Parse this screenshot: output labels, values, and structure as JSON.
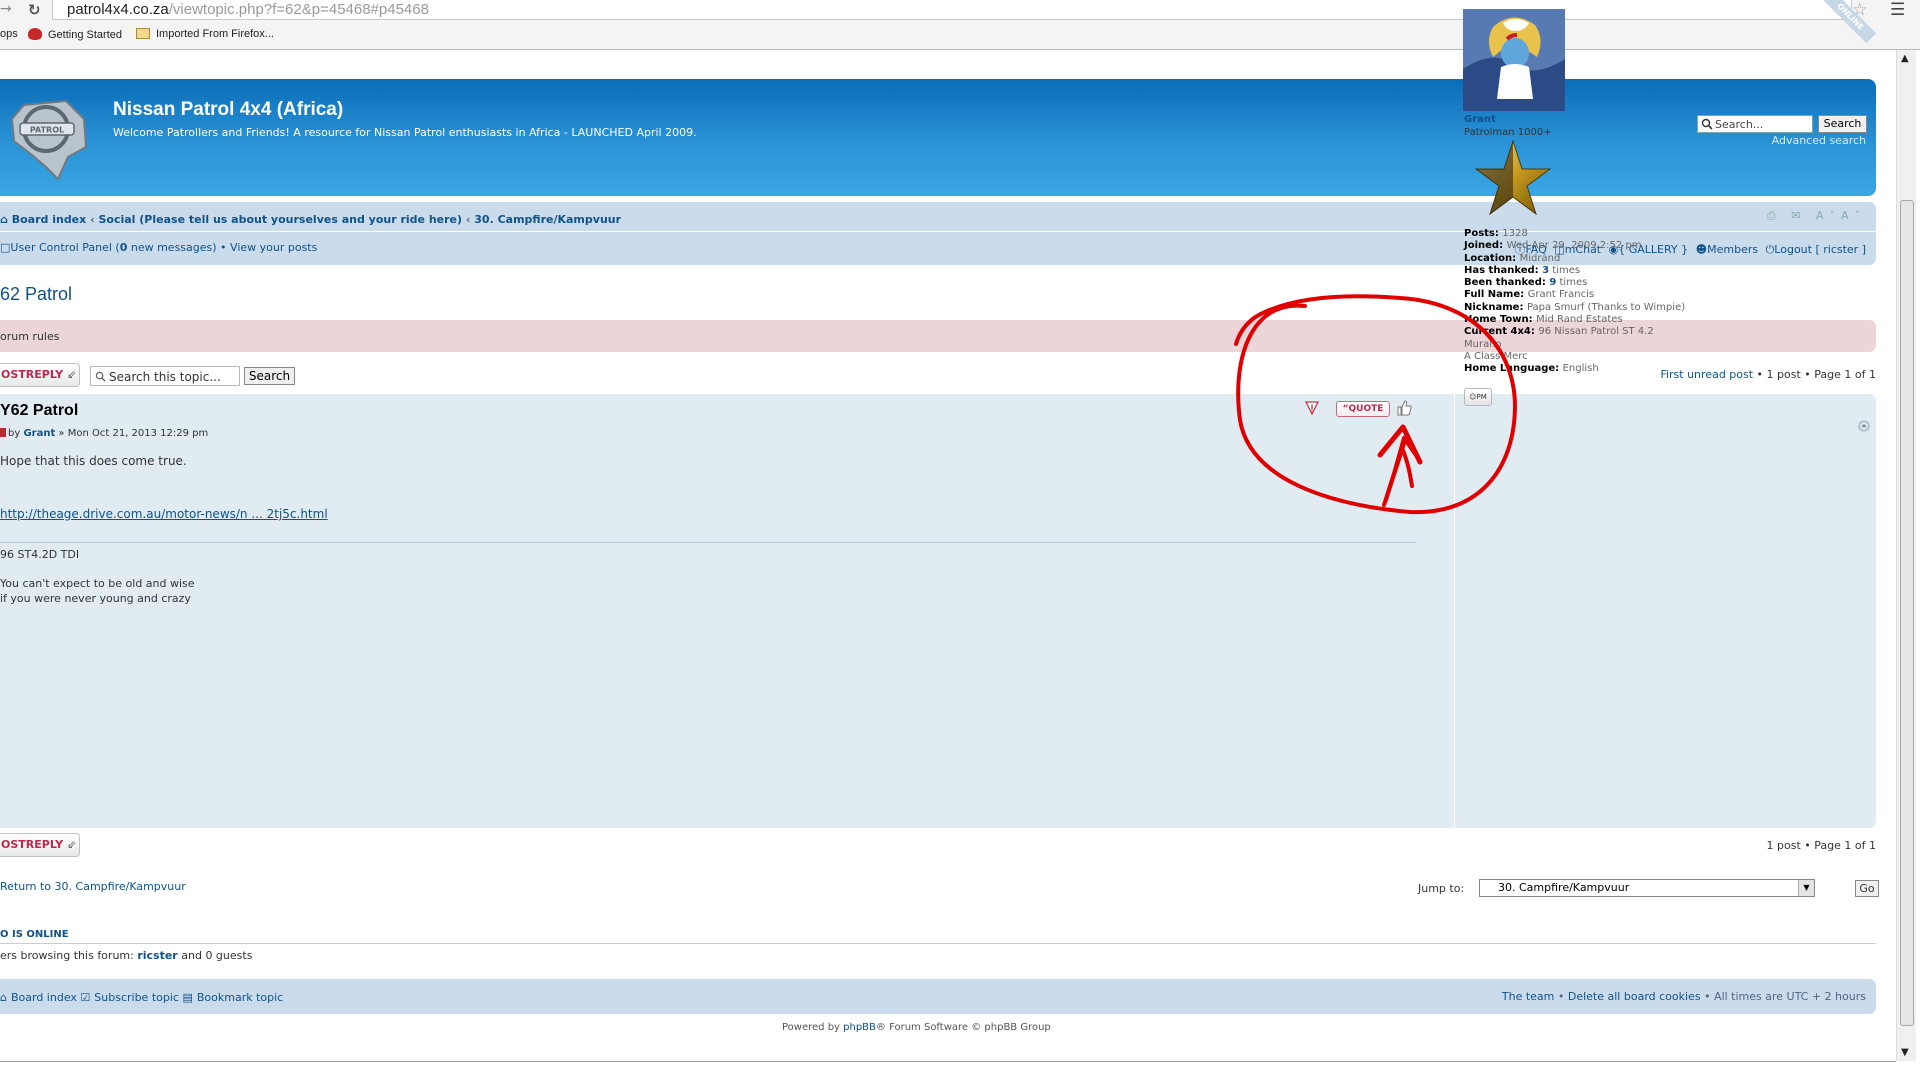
{
  "browser": {
    "url_host": "patrol4x4.co.za",
    "url_path": "/viewtopic.php?f=62&p=45468#p45468",
    "bookmarks": [
      "ops",
      "Getting Started",
      "Imported From Firefox..."
    ]
  },
  "header": {
    "title": "Nissan Patrol 4x4 (Africa)",
    "description": "Welcome Patrollers and Friends! A resource for Nissan Patrol enthusiasts in Africa - LAUNCHED April 2009.",
    "logo_text": "PATROL",
    "search_placeholder": "Search...",
    "search_button": "Search",
    "advanced_search": "Advanced search"
  },
  "navbar": {
    "breadcrumb": [
      "Board index",
      "Social (Please tell us about yourselves and your ride here)",
      "30. Campfire/Kampvuur"
    ],
    "tool_icons": "⎙ ✉ A˅A˄",
    "ucp_prefix": "User Control Panel (",
    "ucp_count": "0",
    "ucp_suffix": " new messages)",
    "view_posts": "• View your posts",
    "faq": "FAQ",
    "mchat": "mChat",
    "gallery": "{ GALLERY }",
    "members": "Members",
    "logout": "Logout [ ricster ]"
  },
  "topic": {
    "title": "62 Patrol",
    "forum_rules": "orum rules",
    "postreply": "OSTREPLY",
    "search_placeholder": "Search this topic...",
    "search_button": "Search",
    "pagination_top_link": "First unread post",
    "pagination_top_rest": " • 1 post • Page 1 of 1",
    "pagination_bottom": "1 post • Page 1 of 1"
  },
  "post": {
    "title": "Y62 Patrol",
    "meta_by": "by ",
    "author": "Grant",
    "meta_date": " » Mon Oct 21, 2013 12:29 pm",
    "body": "Hope that this does come true.",
    "link": "http://theage.drive.com.au/motor-news/n ... 2tj5c.html",
    "sig_line1": "96 ST4.2D TDI",
    "sig_line2": "You can't expect to be old and wise",
    "sig_line3": "if you were never young and crazy",
    "quote_label": "QUOTE",
    "online_label": "ONLINE"
  },
  "profile": {
    "name": "Grant",
    "rank": "Patrolman 1000+",
    "fields": [
      {
        "k": "Posts:",
        "v": "1328"
      },
      {
        "k": "Joined:",
        "v": "Wed Apr 29, 2009 2:52 pm"
      },
      {
        "k": "Location:",
        "v": "Midrand"
      },
      {
        "k": "Has thanked:",
        "n": "3",
        "v": " times"
      },
      {
        "k": "Been thanked:",
        "n": "9",
        "v": " times"
      },
      {
        "k": "Full Name:",
        "v": "Grant Francis"
      },
      {
        "k": "Nickname:",
        "v": "Papa Smurf (Thanks to Wimpie)"
      },
      {
        "k": "Home Town:",
        "v": "Mid Rand Estates"
      },
      {
        "k": "Current 4x4:",
        "v": "96 Nissan Patrol ST 4.2"
      },
      {
        "k": "",
        "v": "Murano"
      },
      {
        "k": "",
        "v": "A Class Merc"
      },
      {
        "k": "Home Language:",
        "v": "English"
      }
    ],
    "pm_label": "PM"
  },
  "bottom": {
    "return_link": "Return to 30. Campfire/Kampvuur",
    "jumpto_label": "Jump to:",
    "jumpto_value": "30. Campfire/Kampvuur",
    "go_button": "Go",
    "who_title": "O IS ONLINE",
    "who_prefix": "ers browsing this forum: ",
    "who_user": "ricster",
    "who_suffix": " and 0 guests"
  },
  "footer": {
    "board_index": "Board index",
    "subscribe": "Subscribe topic",
    "bookmark": "Bookmark topic",
    "the_team": "The team",
    "delete_cookies": "Delete all board cookies",
    "timezone": "• All times are UTC + 2 hours",
    "powered_prefix": "Powered by ",
    "powered_phpbb": "phpBB",
    "powered_suffix": "® Forum Software © phpBB Group"
  },
  "colors": {
    "header_blue": "#0a6db8",
    "nav_bg": "#cadceb",
    "post_bg": "#e1ebf2",
    "link": "#105289",
    "rules_bg": "#ecd5d8",
    "annotation_red": "#e00000"
  }
}
